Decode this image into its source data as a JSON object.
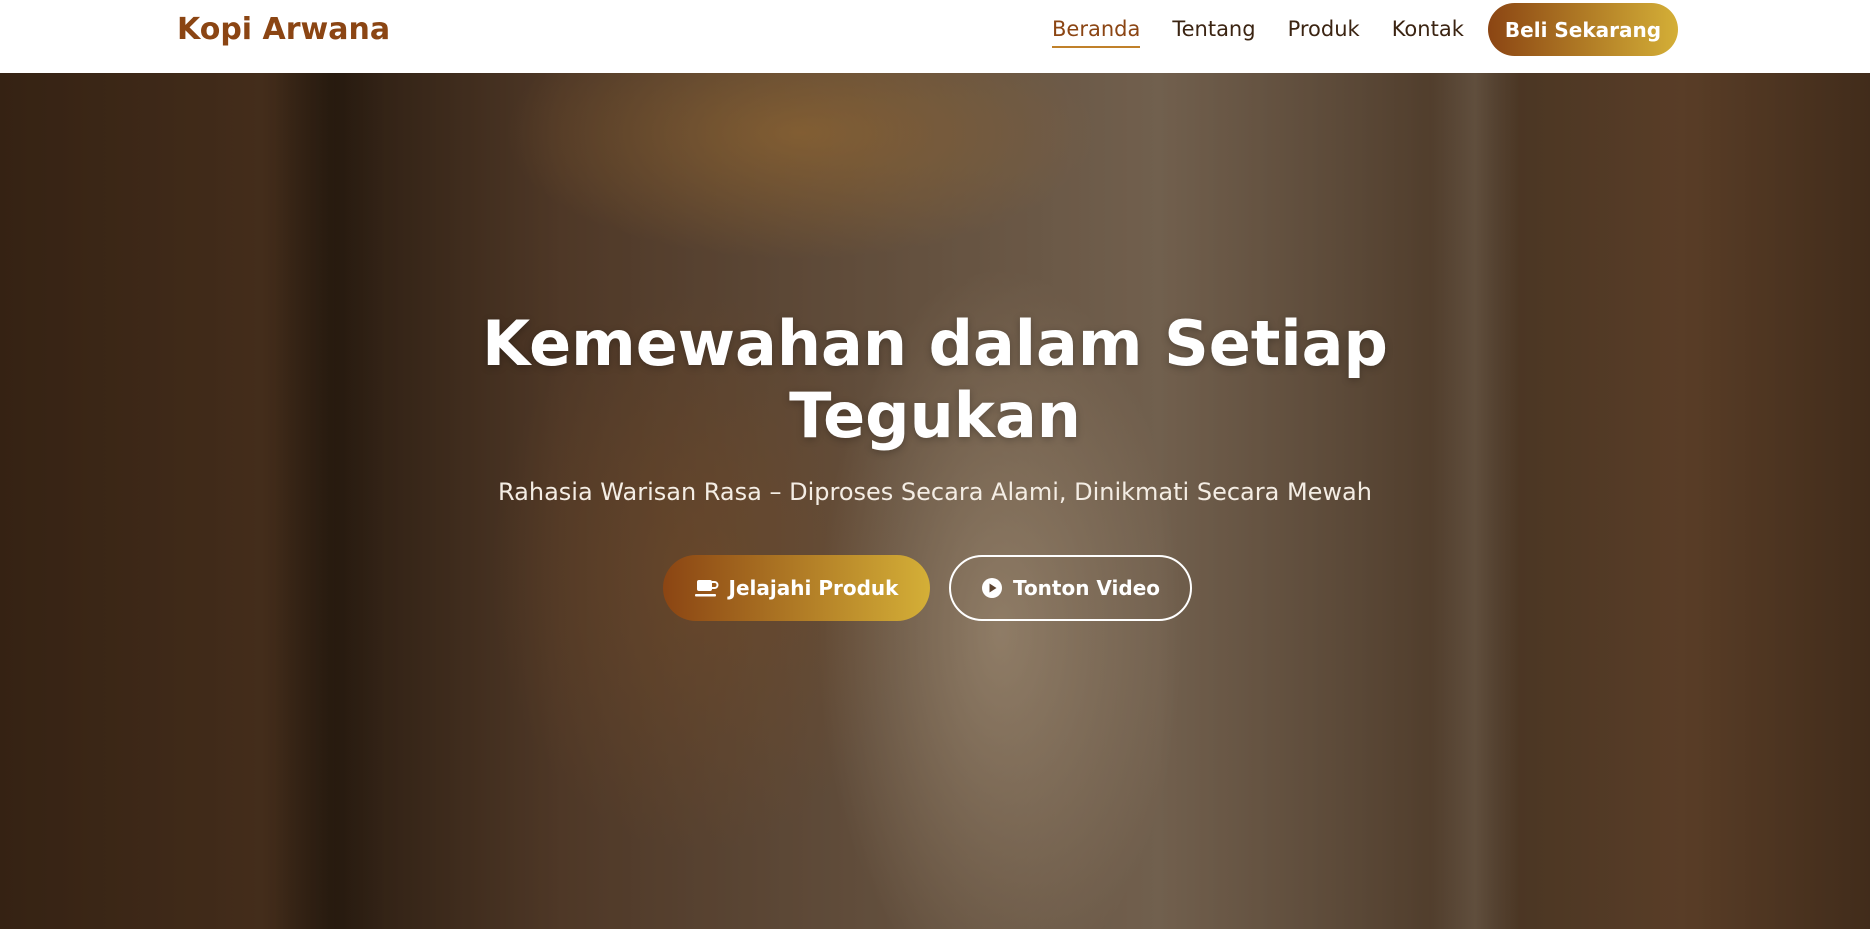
{
  "navbar": {
    "brand": "Kopi Arwana",
    "links": [
      {
        "label": "Beranda",
        "active": true
      },
      {
        "label": "Tentang",
        "active": false
      },
      {
        "label": "Produk",
        "active": false
      },
      {
        "label": "Kontak",
        "active": false
      }
    ],
    "cta_label": "Beli Sekarang"
  },
  "hero": {
    "title_line1": "Kemewahan dalam Setiap",
    "title_line2": "Tegukan",
    "subtitle": "Rahasia Warisan Rasa – Diproses Secara Alami, Dinikmati Secara Mewah",
    "primary_button": {
      "label": "Jelajahi Produk",
      "icon": "coffee-cup-icon"
    },
    "secondary_button": {
      "label": "Tonton Video",
      "icon": "play-circle-icon"
    }
  },
  "colors": {
    "brand": "#8b4513",
    "accent": "#d4af37",
    "nav_text": "#3b2412"
  }
}
